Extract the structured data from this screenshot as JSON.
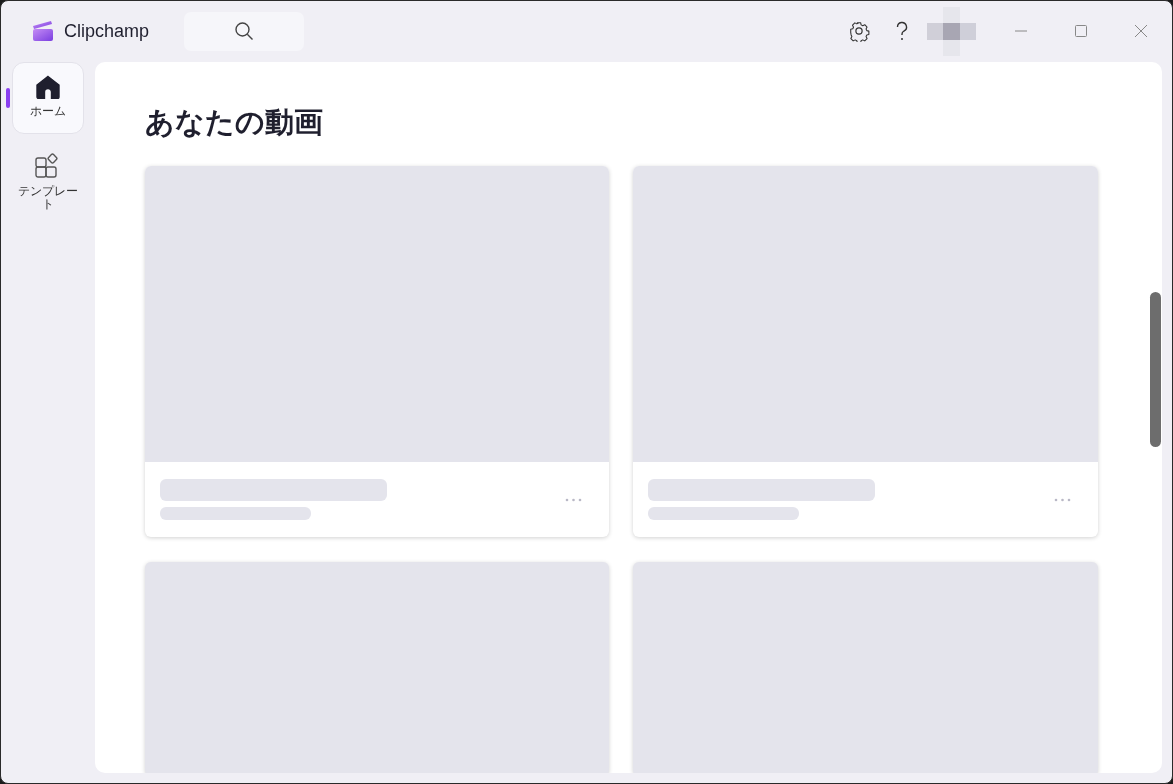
{
  "app": {
    "name": "Clipchamp"
  },
  "sidebar": {
    "items": [
      {
        "label": "ホーム",
        "kind": "home",
        "selected": true
      },
      {
        "label": "テンプレート",
        "kind": "templates",
        "selected": false
      }
    ]
  },
  "main": {
    "heading": "あなたの動画",
    "cards": [
      {
        "kind": "full"
      },
      {
        "kind": "full"
      },
      {
        "kind": "cut"
      },
      {
        "kind": "cut"
      }
    ]
  }
}
